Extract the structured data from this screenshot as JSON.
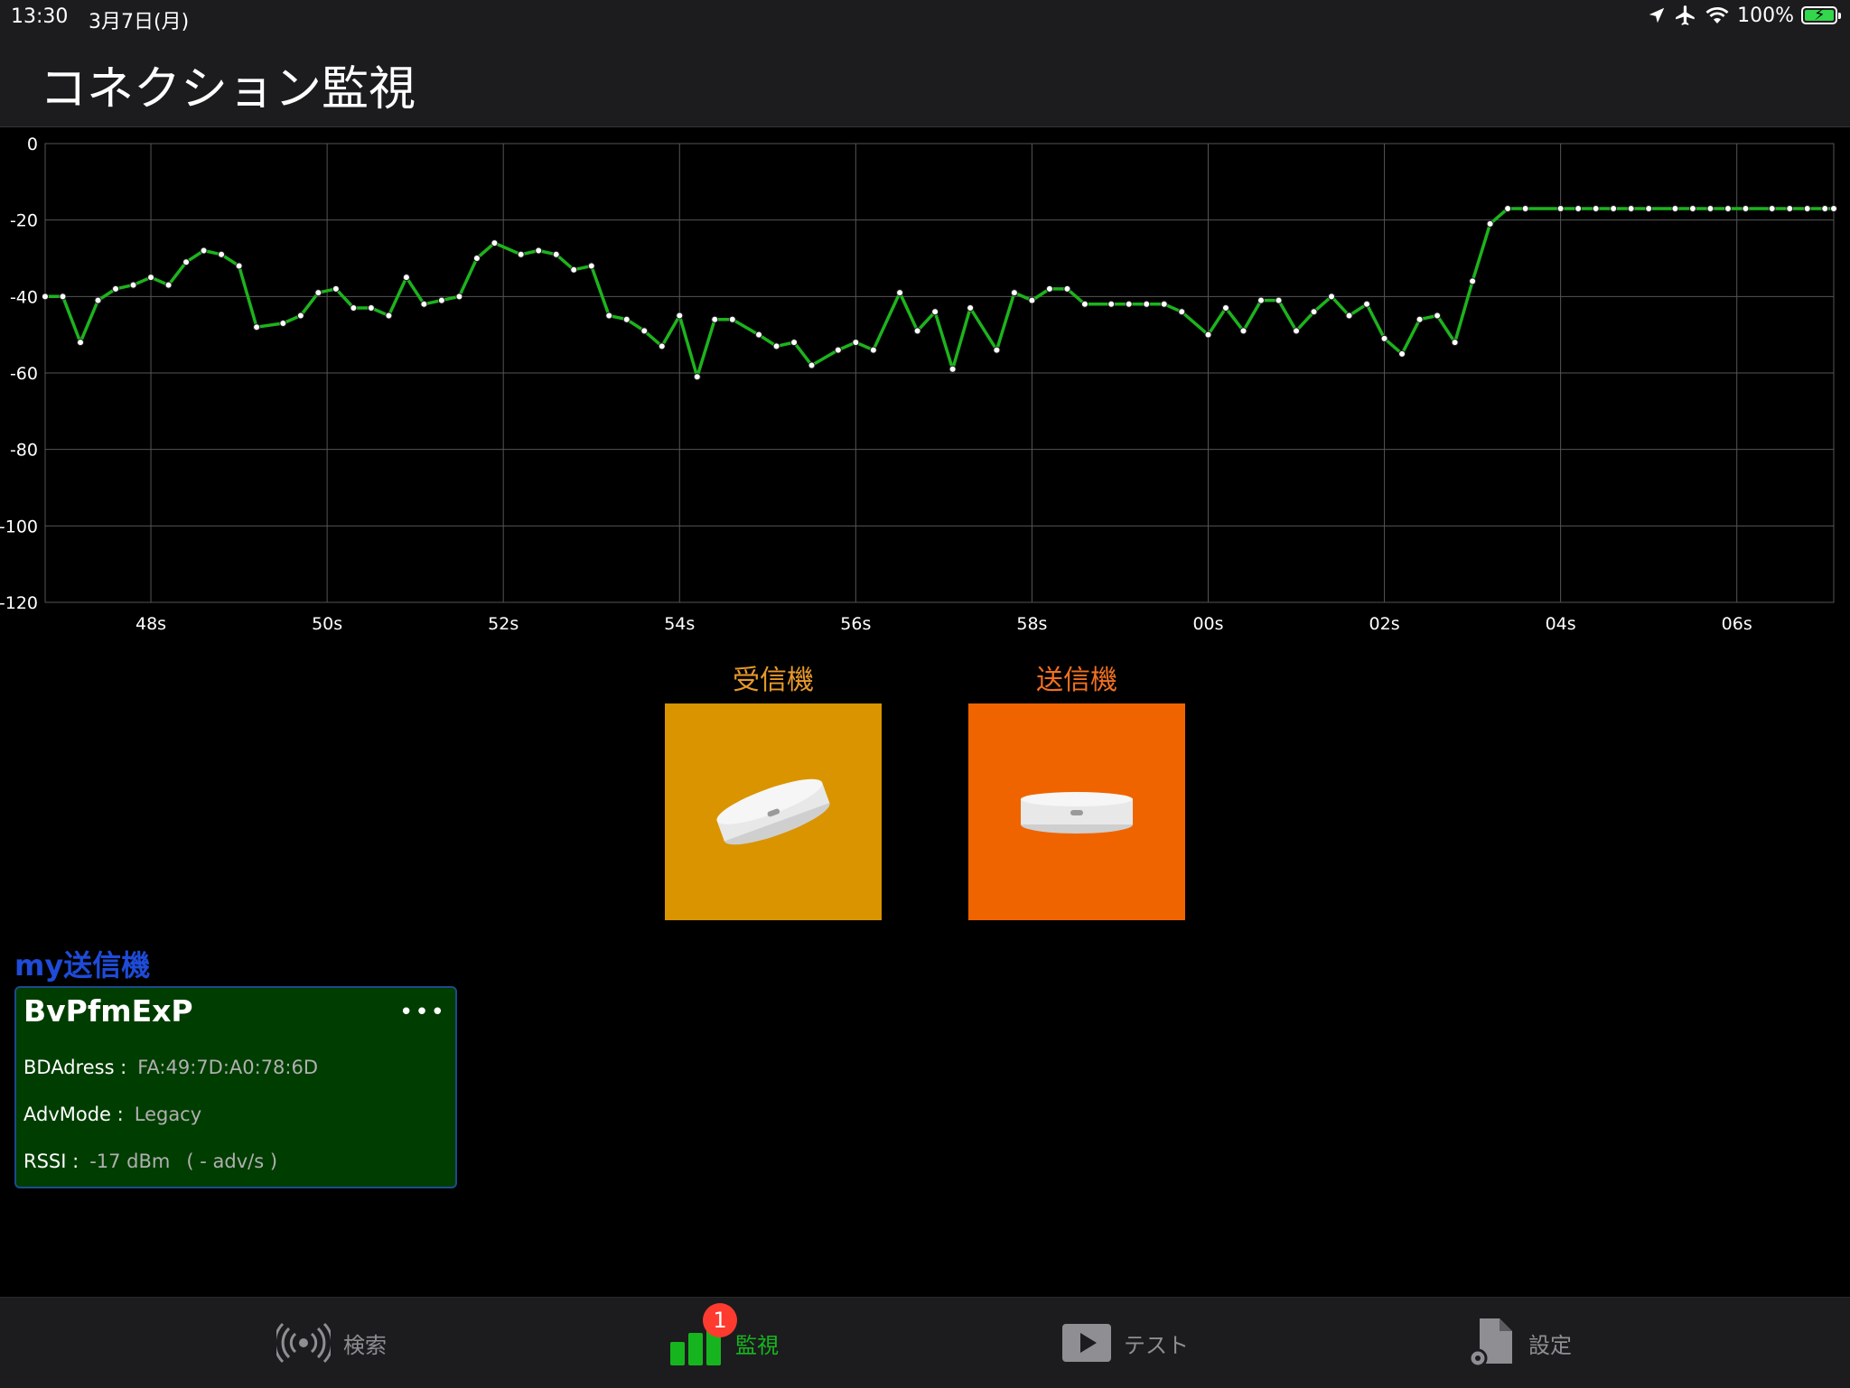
{
  "status_bar": {
    "time": "13:30",
    "date": "3月7日(月)",
    "battery": "100%",
    "icons": [
      "location-arrow-icon",
      "airplane-icon",
      "wifi-icon",
      "battery-icon"
    ]
  },
  "nav": {
    "title": "コネクション監視"
  },
  "colors": {
    "line": "#1db31d",
    "receiver_tile": "#d99400",
    "sender_tile": "#f06400",
    "receiver_label": "#e89a2a",
    "sender_label": "#f07020",
    "card_bg": "#003d00",
    "active_tab": "#16b51f",
    "badge": "#ff3b30"
  },
  "chart_data": {
    "type": "line",
    "x_range": [
      46.8,
      67.1
    ],
    "ylim": [
      -120,
      0
    ],
    "yticks": [
      0,
      -20,
      -40,
      -60,
      -80,
      -100,
      -120
    ],
    "xticks": [
      {
        "x": 48,
        "label": "48s"
      },
      {
        "x": 50,
        "label": "50s"
      },
      {
        "x": 52,
        "label": "52s"
      },
      {
        "x": 54,
        "label": "54s"
      },
      {
        "x": 56,
        "label": "56s"
      },
      {
        "x": 58,
        "label": "58s"
      },
      {
        "x": 60,
        "label": "00s"
      },
      {
        "x": 62,
        "label": "02s"
      },
      {
        "x": 64,
        "label": "04s"
      },
      {
        "x": 66,
        "label": "06s"
      }
    ],
    "grid": true,
    "series": [
      {
        "x": [
          46.8,
          47.0,
          47.2,
          47.4,
          47.6,
          47.8,
          48.0,
          48.2,
          48.4,
          48.6,
          48.8,
          49.0,
          49.2,
          49.5,
          49.7,
          49.9,
          50.1,
          50.3,
          50.5,
          50.7,
          50.9,
          51.1,
          51.3,
          51.5,
          51.7,
          51.9,
          52.2,
          52.4,
          52.6,
          52.8,
          53.0,
          53.2,
          53.4,
          53.6,
          53.8,
          54.0,
          54.2,
          54.4,
          54.6,
          54.9,
          55.1,
          55.3,
          55.5,
          55.8,
          56.0,
          56.2,
          56.5,
          56.7,
          56.9,
          57.1,
          57.3,
          57.6,
          57.8,
          58.0,
          58.2,
          58.4,
          58.6,
          58.9,
          59.1,
          59.3,
          59.5,
          59.7,
          60.0,
          60.2,
          60.4,
          60.6,
          60.8,
          61.0,
          61.2,
          61.4,
          61.6,
          61.8,
          62.0,
          62.2,
          62.4,
          62.6,
          62.8,
          63.0,
          63.2,
          63.4,
          63.6,
          64.0,
          64.2,
          64.4,
          64.6,
          64.8,
          65.0,
          65.3,
          65.5,
          65.7,
          65.9,
          66.1,
          66.4,
          66.6,
          66.8,
          67.0,
          67.1
        ],
        "y": [
          -40,
          -40,
          -52,
          -41,
          -38,
          -37,
          -35,
          -37,
          -31,
          -28,
          -29,
          -32,
          -48,
          -47,
          -45,
          -39,
          -38,
          -43,
          -43,
          -45,
          -35,
          -42,
          -41,
          -40,
          -30,
          -26,
          -29,
          -28,
          -29,
          -33,
          -32,
          -45,
          -46,
          -49,
          -53,
          -45,
          -61,
          -46,
          -46,
          -50,
          -53,
          -52,
          -58,
          -54,
          -52,
          -54,
          -39,
          -49,
          -44,
          -59,
          -43,
          -54,
          -39,
          -41,
          -38,
          -38,
          -42,
          -42,
          -42,
          -42,
          -42,
          -44,
          -50,
          -43,
          -49,
          -41,
          -41,
          -49,
          -44,
          -40,
          -45,
          -42,
          -51,
          -55,
          -46,
          -45,
          -52,
          -36,
          -21,
          -17,
          -17,
          -17,
          -17,
          -17,
          -17,
          -17,
          -17,
          -17,
          -17,
          -17,
          -17,
          -17,
          -17,
          -17,
          -17,
          -17,
          -17
        ]
      }
    ]
  },
  "devices": {
    "receiver_label": "受信機",
    "sender_label": "送信機"
  },
  "card": {
    "section_title": "my送信機",
    "name": "BvPfmExP",
    "more": "•••",
    "bd_label": "BDAdress :",
    "bd_value": "FA:49:7D:A0:78:6D",
    "adv_label": "AdvMode :",
    "adv_value": "Legacy",
    "rssi_label": "RSSI :",
    "rssi_value": "-17 dBm",
    "rate_value": "( - adv/s )"
  },
  "tabs": [
    {
      "label": "検索",
      "icon": "broadcast-icon",
      "active": false
    },
    {
      "label": "監視",
      "icon": "bar-chart-icon",
      "active": true,
      "badge": "1"
    },
    {
      "label": "テスト",
      "icon": "play-icon",
      "active": false
    },
    {
      "label": "設定",
      "icon": "settings-doc-icon",
      "active": false
    }
  ]
}
